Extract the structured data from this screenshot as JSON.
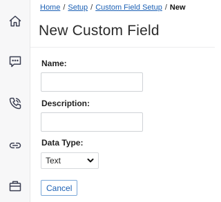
{
  "sidebar": {
    "icons": [
      "home-icon",
      "chat-icon",
      "phone-icon",
      "link-icon",
      "briefcase-icon"
    ]
  },
  "breadcrumb": {
    "items": [
      "Home",
      "Setup",
      "Custom Field Setup"
    ],
    "current": "New",
    "separator": "/"
  },
  "page": {
    "title": "New Custom Field"
  },
  "form": {
    "name_label": "Name:",
    "name_value": "",
    "description_label": "Description:",
    "description_value": "",
    "data_type_label": "Data Type:",
    "data_type_value": "Text",
    "cancel_label": "Cancel"
  },
  "colors": {
    "link": "#1a5fb4",
    "sidebar_icon": "#3b3f52"
  }
}
